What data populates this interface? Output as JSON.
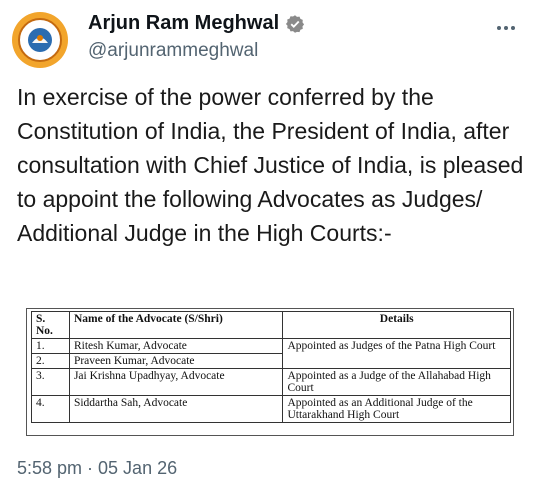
{
  "author": {
    "display_name": "Arjun Ram Meghwal",
    "handle": "@arjunrammeghwal",
    "avatar_icon": "emblem-logo-icon",
    "verified_icon": "verified-badge-icon",
    "verified_color": "#1d9bf0"
  },
  "tweet": {
    "text": "In exercise of the power conferred by the Constitution of India, the President of India, after consultation with Chief Justice of India, is pleased to appoint the following Advocates as Judges/ Additional Judge in the High Courts:-"
  },
  "table": {
    "headers": {
      "sno": "S. No.",
      "name": "Name of the Advocate (S/Shri)",
      "details": "Details"
    },
    "rows": [
      {
        "sno": "1.",
        "name": "Ritesh Kumar, Advocate",
        "details": "Appointed as Judges of the Patna High Court"
      },
      {
        "sno": "2.",
        "name": "Praveen Kumar, Advocate",
        "details": ""
      },
      {
        "sno": "3.",
        "name": "Jai Krishna Upadhyay, Advocate",
        "details": "Appointed as a Judge of the Allahabad High Court"
      },
      {
        "sno": "4.",
        "name": "Siddartha Sah, Advocate",
        "details": "Appointed as an Additional Judge of the Uttarakhand High Court"
      }
    ]
  },
  "timestamp": "5:58 pm · 05 Jan 26",
  "more_icon": "more-options-icon"
}
